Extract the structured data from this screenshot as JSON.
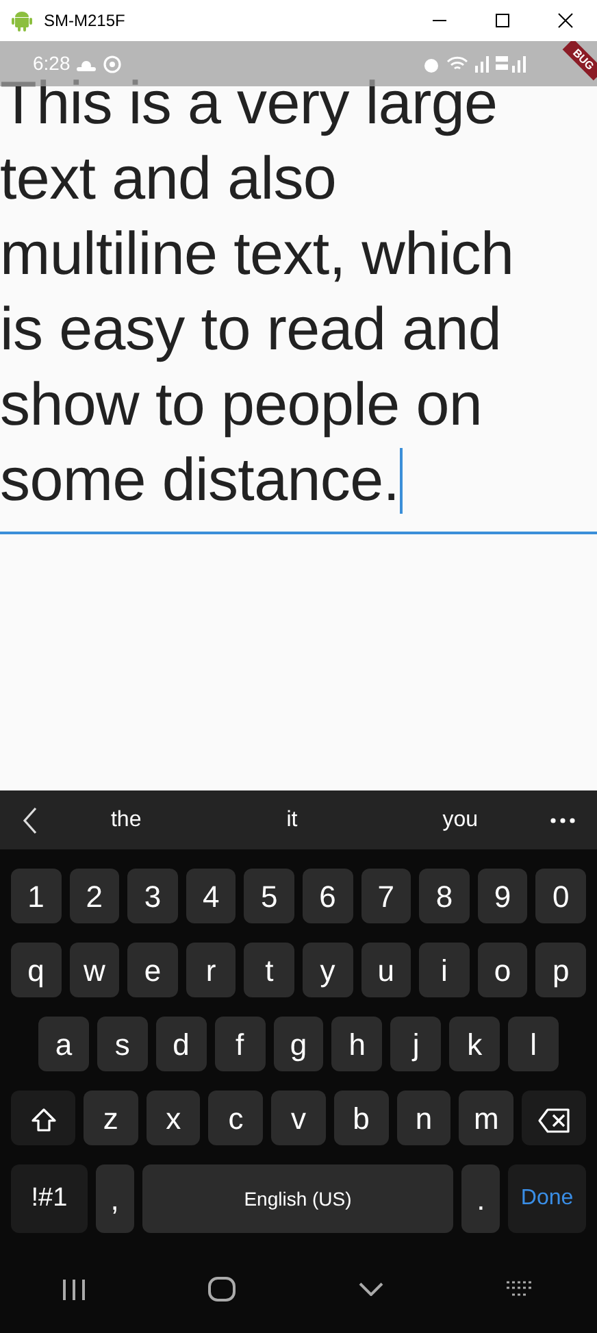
{
  "window": {
    "title": "SM-M215F"
  },
  "status_bar": {
    "time": "6:28",
    "debug_banner": "BUG"
  },
  "text_field": {
    "value": "This is a very large text and also multiline text, which is easy to read and show to people on some distance.",
    "focused": true
  },
  "keyboard": {
    "suggestions": [
      "the",
      "it",
      "you"
    ],
    "rows": [
      {
        "keys": [
          {
            "label": "1"
          },
          {
            "label": "2"
          },
          {
            "label": "3"
          },
          {
            "label": "4"
          },
          {
            "label": "5"
          },
          {
            "label": "6"
          },
          {
            "label": "7"
          },
          {
            "label": "8"
          },
          {
            "label": "9"
          },
          {
            "label": "0"
          }
        ]
      },
      {
        "keys": [
          {
            "label": "q"
          },
          {
            "label": "w"
          },
          {
            "label": "e"
          },
          {
            "label": "r"
          },
          {
            "label": "t"
          },
          {
            "label": "y"
          },
          {
            "label": "u"
          },
          {
            "label": "i"
          },
          {
            "label": "o"
          },
          {
            "label": "p"
          }
        ]
      },
      {
        "keys": [
          {
            "label": "a"
          },
          {
            "label": "s"
          },
          {
            "label": "d"
          },
          {
            "label": "f"
          },
          {
            "label": "g"
          },
          {
            "label": "h"
          },
          {
            "label": "j"
          },
          {
            "label": "k"
          },
          {
            "label": "l"
          }
        ]
      },
      {
        "keys": [
          {
            "kind": "shift"
          },
          {
            "label": "z"
          },
          {
            "label": "x"
          },
          {
            "label": "c"
          },
          {
            "label": "v"
          },
          {
            "label": "b"
          },
          {
            "label": "n"
          },
          {
            "label": "m"
          },
          {
            "kind": "backspace"
          }
        ]
      },
      {
        "keys": [
          {
            "kind": "symbols",
            "label": "!#1"
          },
          {
            "label": ","
          },
          {
            "kind": "space",
            "label": "English (US)"
          },
          {
            "label": "."
          },
          {
            "kind": "action",
            "label": "Done"
          }
        ]
      }
    ]
  }
}
